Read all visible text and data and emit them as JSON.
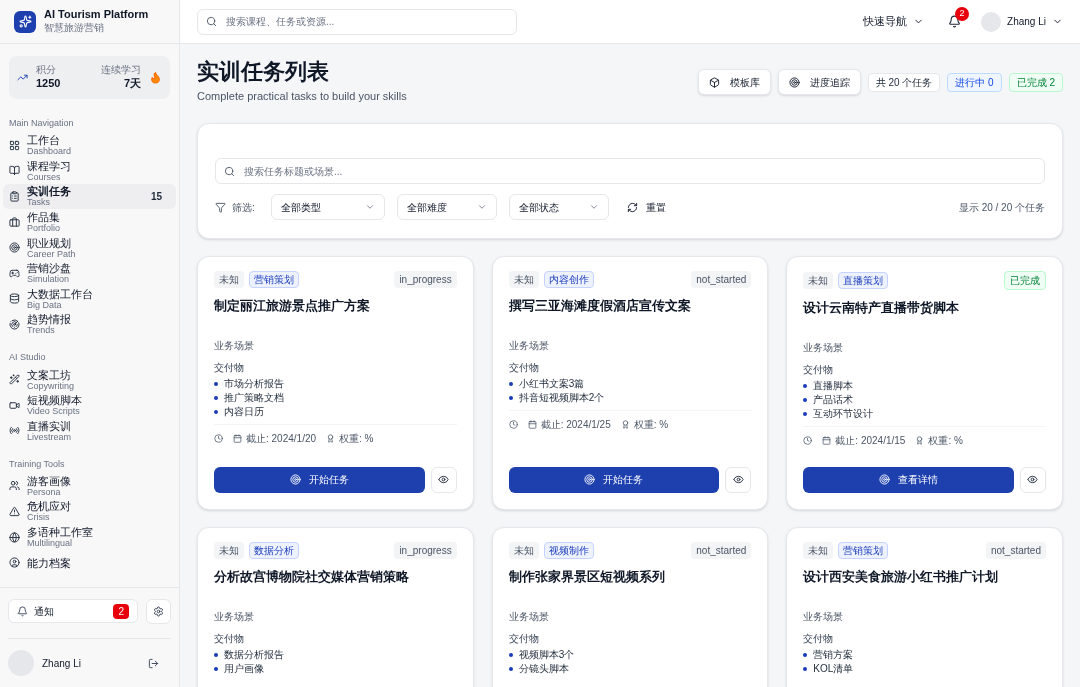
{
  "brand": {
    "title": "AI Tourism Platform",
    "subtitle": "智慧旅游营销"
  },
  "stats": {
    "points_label": "积分",
    "points": "1250",
    "streak_label": "连续学习",
    "streak": "7天"
  },
  "nav_sections": [
    {
      "title": "Main Navigation",
      "items": [
        {
          "label": "工作台",
          "sub": "Dashboard",
          "selected": false
        },
        {
          "label": "课程学习",
          "sub": "Courses",
          "selected": false
        },
        {
          "label": "实训任务",
          "sub": "Tasks",
          "selected": true,
          "badge": "15"
        },
        {
          "label": "作品集",
          "sub": "Portfolio",
          "selected": false
        },
        {
          "label": "职业规划",
          "sub": "Career Path",
          "selected": false
        },
        {
          "label": "营销沙盘",
          "sub": "Simulation",
          "selected": false
        },
        {
          "label": "大数据工作台",
          "sub": "Big Data",
          "selected": false
        },
        {
          "label": "趋势情报",
          "sub": "Trends",
          "selected": false
        }
      ]
    },
    {
      "title": "AI Studio",
      "items": [
        {
          "label": "文案工坊",
          "sub": "Copywriting",
          "selected": false
        },
        {
          "label": "短视频脚本",
          "sub": "Video Scripts",
          "selected": false
        },
        {
          "label": "直播实训",
          "sub": "Livestream",
          "selected": false
        }
      ]
    },
    {
      "title": "Training Tools",
      "items": [
        {
          "label": "游客画像",
          "sub": "Persona",
          "selected": false
        },
        {
          "label": "危机应对",
          "sub": "Crisis",
          "selected": false
        },
        {
          "label": "多语种工作室",
          "sub": "Multilingual",
          "selected": false
        },
        {
          "label": "能力档案",
          "selected": false
        }
      ]
    }
  ],
  "notice": {
    "label": "通知",
    "count": "2"
  },
  "user": {
    "name": "Zhang Li"
  },
  "topbar": {
    "search_placeholder": "搜索课程、任务或资源...",
    "quick_nav": "快速导航",
    "bell_count": "2",
    "user": "Zhang Li"
  },
  "page": {
    "title": "实训任务列表",
    "subtitle": "Complete practical tasks to build your skills",
    "actions": [
      "模板库",
      "进度追踪"
    ],
    "counters": [
      {
        "text": "共 20 个任务",
        "kind": "total"
      },
      {
        "text": "进行中 0",
        "kind": "progress"
      },
      {
        "text": "已完成 2",
        "kind": "done"
      }
    ]
  },
  "filters": {
    "search_placeholder": "搜索任务标题或场景...",
    "label": "筛选:",
    "selects": [
      "全部类型",
      "全部难度",
      "全部状态"
    ],
    "reset": "重置",
    "summary": "显示 20 / 20 个任务"
  },
  "tasks": [
    {
      "level": "未知",
      "category": "营销策划",
      "status": "in_progress",
      "done": false,
      "title": "制定丽江旅游景点推广方案",
      "scenario_label": "业务场景",
      "deliverables_label": "交付物",
      "deliverables": [
        "市场分析报告",
        "推广策略文档",
        "内容日历"
      ],
      "deadline": "截止: 2024/1/20",
      "weight": "权重: %",
      "action": "开始任务"
    },
    {
      "level": "未知",
      "category": "内容创作",
      "status": "not_started",
      "done": false,
      "title": "撰写三亚海滩度假酒店宣传文案",
      "scenario_label": "业务场景",
      "deliverables_label": "交付物",
      "deliverables": [
        "小红书文案3篇",
        "抖音短视频脚本2个"
      ],
      "deadline": "截止: 2024/1/25",
      "weight": "权重: %",
      "action": "开始任务"
    },
    {
      "level": "未知",
      "category": "直播策划",
      "status": "已完成",
      "done": true,
      "title": "设计云南特产直播带货脚本",
      "scenario_label": "业务场景",
      "deliverables_label": "交付物",
      "deliverables": [
        "直播脚本",
        "产品话术",
        "互动环节设计"
      ],
      "deadline": "截止: 2024/1/15",
      "weight": "权重: %",
      "action": "查看详情"
    },
    {
      "level": "未知",
      "category": "数据分析",
      "status": "in_progress",
      "done": false,
      "title": "分析故宫博物院社交媒体营销策略",
      "scenario_label": "业务场景",
      "deliverables_label": "交付物",
      "deliverables": [
        "数据分析报告",
        "用户画像"
      ]
    },
    {
      "level": "未知",
      "category": "视频制作",
      "status": "not_started",
      "done": false,
      "title": "制作张家界景区短视频系列",
      "scenario_label": "业务场景",
      "deliverables_label": "交付物",
      "deliverables": [
        "视频脚本3个",
        "分镜头脚本"
      ]
    },
    {
      "level": "未知",
      "category": "营销策划",
      "status": "not_started",
      "done": false,
      "title": "设计西安美食旅游小红书推广计划",
      "scenario_label": "业务场景",
      "deliverables_label": "交付物",
      "deliverables": [
        "营销方案",
        "KOL清单"
      ]
    }
  ]
}
